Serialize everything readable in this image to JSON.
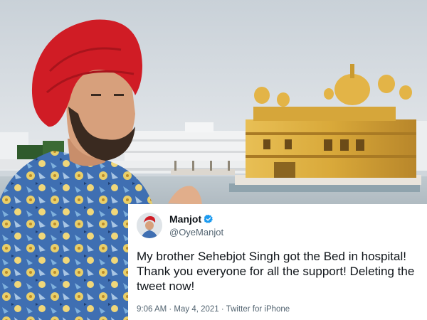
{
  "tweet": {
    "display_name": "Manjot",
    "handle": "@OyeManjot",
    "text": "My brother Sehebjot Singh got the Bed in hospital! Thank you everyone for all the support! Deleting the tweet now!",
    "meta": "9:06 AM · May 4, 2021 · Twitter for iPhone",
    "verified_icon": "verified-badge-icon"
  },
  "colors": {
    "verified": "#1d9bf0",
    "turban": "#d01c25",
    "temple_gold": "#d9a93a",
    "shirt": "#3f6fb2"
  }
}
